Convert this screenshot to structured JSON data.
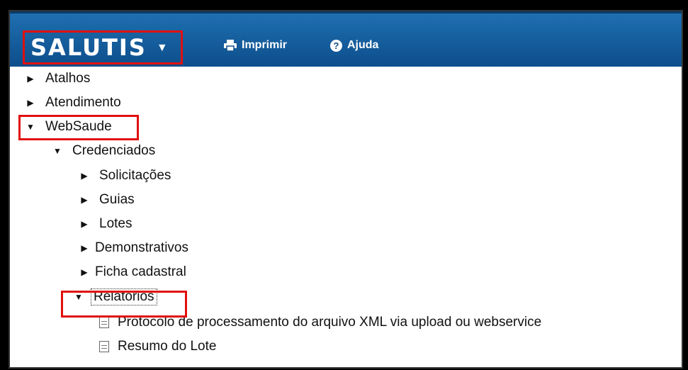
{
  "header": {
    "brand": "SALUTIS",
    "brand_caret": "▼",
    "print_label": "Imprimir",
    "help_label": "Ajuda"
  },
  "tree": {
    "atalhos": "Atalhos",
    "atendimento": "Atendimento",
    "websaude": "WebSaude",
    "credenciados": "Credenciados",
    "solicitacoes": "Solicitações",
    "guias": "Guias",
    "lotes": "Lotes",
    "demonstrativos": "Demonstrativos",
    "ficha": "Ficha cadastral",
    "relatorios": "Relatórios",
    "protocolo": "Protocolo de processamento do arquivo XML via upload ou webservice",
    "resumo": "Resumo do Lote"
  },
  "icons": {
    "collapsed": "▶",
    "expanded": "▼"
  }
}
